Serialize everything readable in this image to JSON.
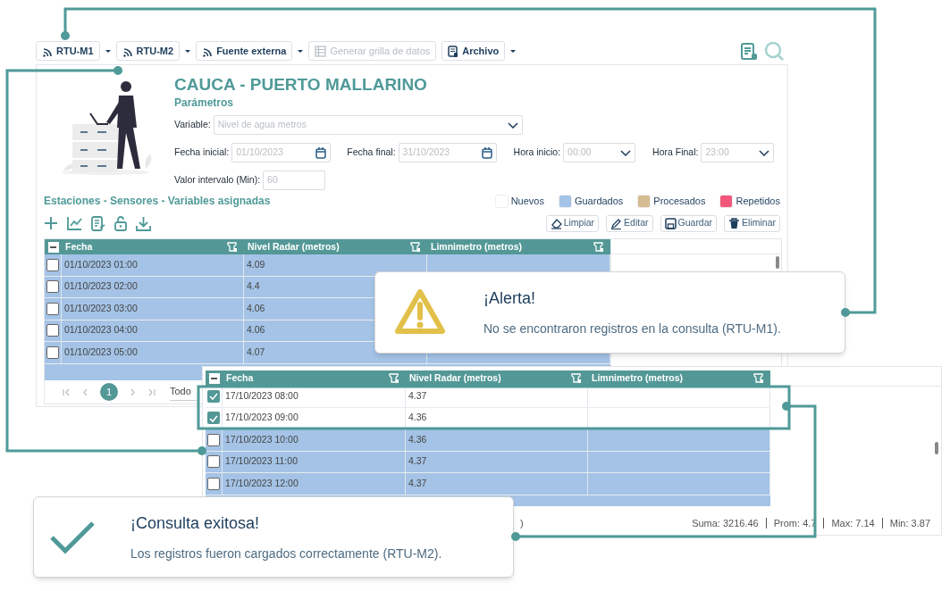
{
  "toolbar": {
    "buttons": [
      {
        "label": "RTU-M1",
        "kind": "feed",
        "disabled": false,
        "dropdown": true
      },
      {
        "label": "RTU-M2",
        "kind": "feed",
        "disabled": false,
        "dropdown": true
      },
      {
        "label": "Fuente externa",
        "kind": "feed",
        "disabled": false,
        "dropdown": true
      },
      {
        "label": "Generar grilla de datos",
        "kind": "grid",
        "disabled": true,
        "dropdown": false
      },
      {
        "label": "Archivo",
        "kind": "file",
        "disabled": false,
        "dropdown": true
      }
    ]
  },
  "station_title": "CAUCA - PUERTO MALLARINO",
  "parameters": {
    "title": "Parámetros",
    "fields": [
      {
        "label": "Variable:",
        "placeholder": "Nivel de agua metros",
        "kind": "select"
      },
      {
        "label": "Fecha inicial:",
        "placeholder": "01/10/2023",
        "kind": "date"
      },
      {
        "label": "Fecha final:",
        "placeholder": "31/10/2023",
        "kind": "date"
      },
      {
        "label": "Hora inicio:",
        "placeholder": "00:00",
        "kind": "select"
      },
      {
        "label": "Hora Final:",
        "placeholder": "23:00",
        "kind": "select"
      },
      {
        "label": "Valor intervalo (Min):",
        "placeholder": "60",
        "kind": "text"
      }
    ]
  },
  "section_title": "Estaciones - Sensores - Variables asignadas",
  "legend": [
    {
      "label": "Nuevos",
      "color": "#ffffff"
    },
    {
      "label": "Guardados",
      "color": "#a4c3e6"
    },
    {
      "label": "Procesados",
      "color": "#d5bc91"
    },
    {
      "label": "Repetidos",
      "color": "#f2577b"
    }
  ],
  "actions": [
    {
      "label": "Limpiar",
      "kind": "eraser"
    },
    {
      "label": "Editar",
      "kind": "pencil"
    },
    {
      "label": "Guardar",
      "kind": "save"
    },
    {
      "label": "Eliminar",
      "kind": "trash"
    }
  ],
  "grid_1": {
    "select_all_partial": true,
    "columns": [
      "Fecha",
      "Nivel Radar (metros)",
      "Limnimetro (metros)"
    ],
    "rows": [
      {
        "selected": false,
        "cells": [
          "01/10/2023 01:00",
          "4.09"
        ]
      },
      {
        "selected": false,
        "cells": [
          "01/10/2023 02:00",
          "4.4"
        ]
      },
      {
        "selected": false,
        "cells": [
          "01/10/2023 03:00",
          "4.06"
        ]
      },
      {
        "selected": false,
        "cells": [
          "01/10/2023 04:00",
          "4.06"
        ]
      },
      {
        "selected": false,
        "cells": [
          "01/10/2023 05:00",
          "4.07"
        ]
      }
    ],
    "pages": [
      {
        "label": "1",
        "selected": true
      }
    ],
    "page_size": "Todo"
  },
  "grid_2": {
    "select_all_partial": true,
    "columns": [
      "Fecha",
      "Nivel Radar (metros)",
      "Limnimetro (metros)"
    ],
    "rows": [
      {
        "selected": true,
        "cells": [
          "17/10/2023 08:00",
          "4.37"
        ]
      },
      {
        "selected": true,
        "cells": [
          "17/10/2023 09:00",
          "4.36"
        ]
      },
      {
        "selected": false,
        "cells": [
          "17/10/2023 10:00",
          "4.36"
        ]
      },
      {
        "selected": false,
        "cells": [
          "17/10/2023 11:00",
          "4.37"
        ]
      },
      {
        "selected": false,
        "cells": [
          "17/10/2023 12:00",
          "4.37"
        ]
      }
    ],
    "footer_fragment": ")",
    "summary": [
      "Suma: 3216.46",
      "Prom: 4.7",
      "Max: 7.14",
      "Min: 3.87"
    ]
  },
  "alert": {
    "title": "¡Alerta!",
    "message": "No se encontraron registros en la consulta (RTU-M1)."
  },
  "success": {
    "title": "¡Consulta exitosa!",
    "message": "Los registros fueron cargados correctamente (RTU-M2)."
  }
}
